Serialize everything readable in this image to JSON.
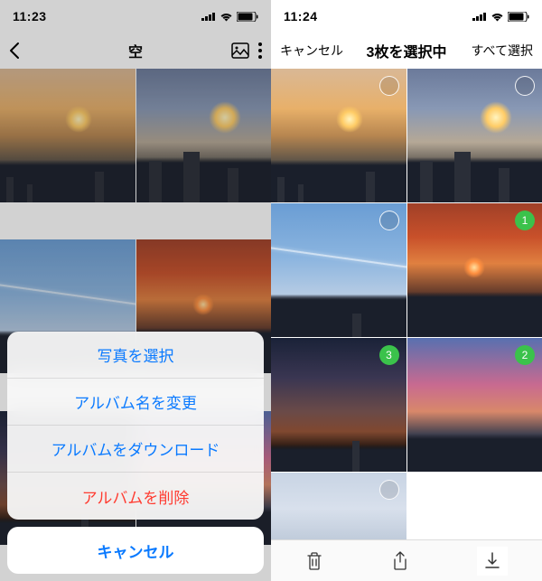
{
  "left": {
    "time": "11:23",
    "title": "空",
    "sheet": {
      "select": "写真を選択",
      "rename": "アルバム名を変更",
      "download": "アルバムをダウンロード",
      "delete": "アルバムを削除",
      "cancel": "キャンセル"
    }
  },
  "right": {
    "time": "11:24",
    "cancel": "キャンセル",
    "title": "3枚を選択中",
    "select_all": "すべて選択",
    "selection": {
      "rows": [
        [
          {
            "selected": false
          },
          {
            "selected": false
          }
        ],
        [
          {
            "selected": false
          },
          {
            "selected": true,
            "order": 1
          }
        ],
        [
          {
            "selected": true,
            "order": 3
          },
          {
            "selected": true,
            "order": 2
          }
        ],
        [
          {
            "selected": false
          }
        ]
      ]
    }
  }
}
